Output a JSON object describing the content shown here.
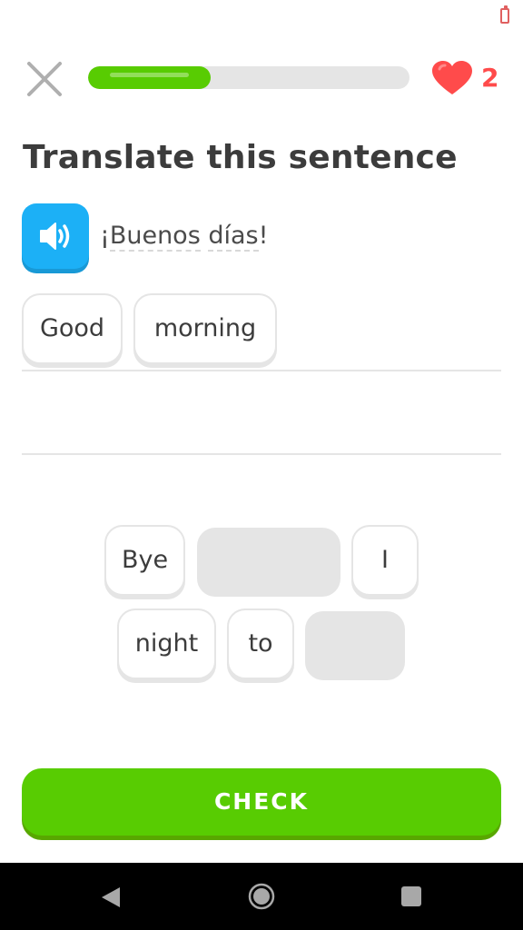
{
  "header": {
    "close_icon": "close-icon",
    "progress_percent": 38,
    "hearts_count": "2",
    "heart_icon": "heart-icon",
    "accent_color": "#58cc02"
  },
  "prompt": {
    "title": "Translate this sentence",
    "speaker_icon": "speaker-icon",
    "source_sentence": {
      "prefix": "¡",
      "word1": "Buenos",
      "word2": "días",
      "suffix": "!"
    }
  },
  "answer": {
    "selected_words": [
      "Good",
      "morning"
    ]
  },
  "word_bank": {
    "row1": [
      "Bye",
      "",
      "I"
    ],
    "row2": [
      "night",
      "to",
      ""
    ]
  },
  "check_button": {
    "label": "CHECK"
  },
  "navbar": {
    "back_icon": "back-icon",
    "home_icon": "home-icon",
    "recents_icon": "recents-icon"
  }
}
